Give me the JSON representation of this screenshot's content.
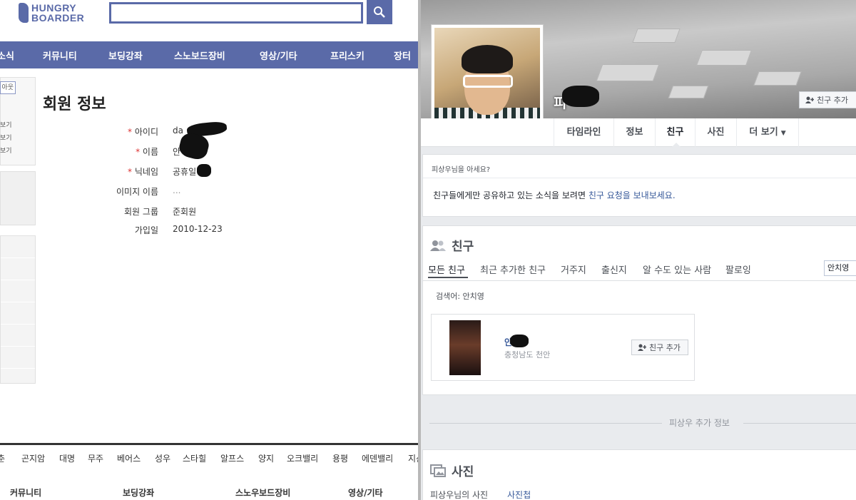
{
  "left_site": {
    "logo": {
      "line1": "HUNGRY",
      "line2": "BOARDER"
    },
    "search": {
      "value": ""
    },
    "nav": [
      "소식",
      "커뮤니티",
      "보딩강좌",
      "스노보드장비",
      "영상/기타",
      "프리스키",
      "장터"
    ],
    "sidebar": {
      "button_label": "아웃",
      "links": [
        "보기",
        "보기",
        "보기"
      ]
    },
    "page_title": "회원 정보",
    "member_info": [
      {
        "label": "아이디",
        "required": true,
        "value": "da"
      },
      {
        "label": "이름",
        "required": true,
        "value": "안"
      },
      {
        "label": "닉네임",
        "required": true,
        "value": "공휴일"
      },
      {
        "label": "이미지 이름",
        "required": false,
        "value": "..."
      },
      {
        "label": "회원 그룹",
        "required": false,
        "value": "준회원"
      },
      {
        "label": "가입일",
        "required": false,
        "value": "2010-12-23"
      }
    ],
    "resorts": [
      "춘",
      "곤지암",
      "대명",
      "무주",
      "베어스",
      "성우",
      "스타힐",
      "알프스",
      "양지",
      "오크밸리",
      "용평",
      "에덴밸리",
      "지산"
    ],
    "footer_nav": [
      "커뮤니티",
      "보딩강좌",
      "스노우보드장비",
      "영상/기타"
    ],
    "colors": {
      "brand": "#5a6aa8",
      "required_mark": "#dd3333"
    }
  },
  "right_site": {
    "profile_name": "피",
    "cover_add_friend": "친구 추가",
    "tabs": [
      "타임라인",
      "정보",
      "친구",
      "사진",
      "더 보기"
    ],
    "active_tab": "친구",
    "know_panel": {
      "heading": "피상우님을 아세요?",
      "text": "친구들에게만 공유하고 있는 소식을 보려면",
      "link": "친구 요청을 보내보세요."
    },
    "friends_section": {
      "title": "친구",
      "filters": [
        "모든 친구",
        "최근 추가한 친구",
        "거주지",
        "출신지",
        "알 수도 있는 사람",
        "팔로잉"
      ],
      "search_value": "안치영",
      "search_label": "검색어: 안치영",
      "result": {
        "name": "안",
        "location": "충청남도 천안",
        "button": "친구 추가"
      }
    },
    "more_info_label": "피상우 추가 정보",
    "photos_section": {
      "title": "사진",
      "tabs": [
        "피상우님의 사진",
        "사진첩"
      ]
    },
    "colors": {
      "link": "#365899",
      "background": "#e9ebee"
    }
  }
}
